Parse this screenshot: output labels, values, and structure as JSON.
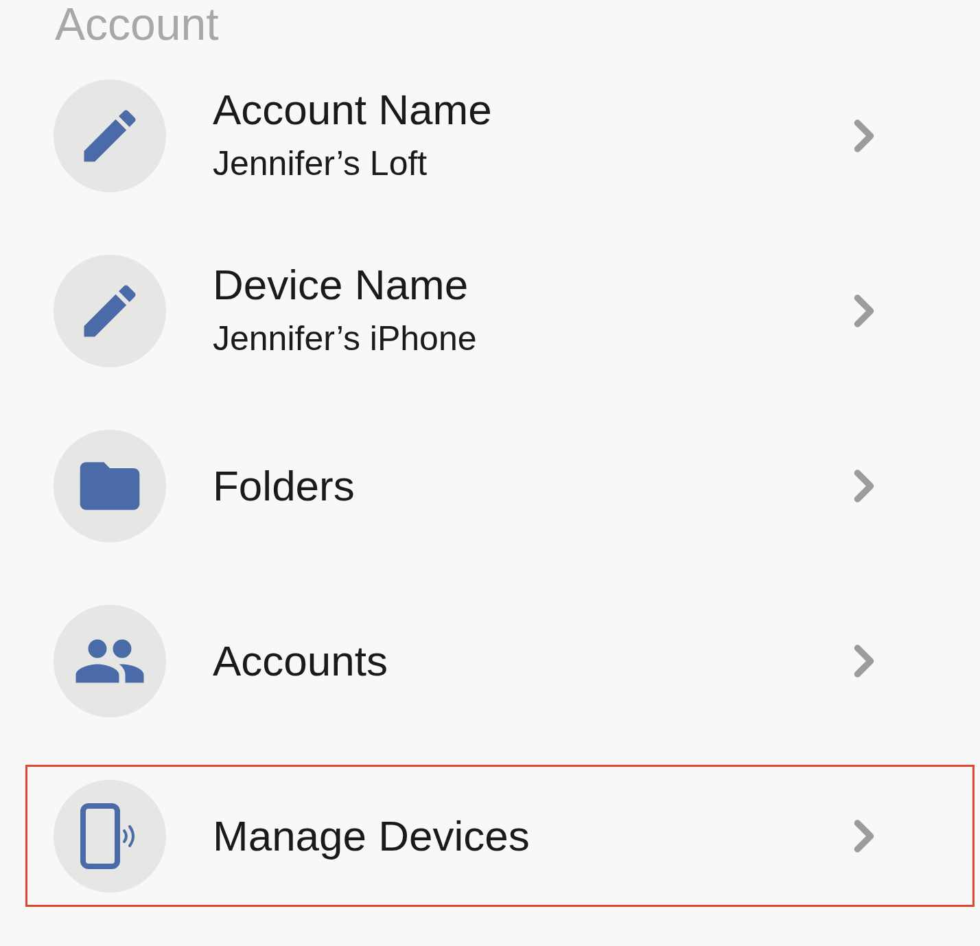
{
  "section_title": "Account",
  "items": [
    {
      "kind": "edit",
      "title": "Account Name",
      "subtitle": "Jennifer’s Loft",
      "highlighted": false
    },
    {
      "kind": "edit",
      "title": "Device Name",
      "subtitle": "Jennifer’s iPhone",
      "highlighted": false
    },
    {
      "kind": "folder",
      "title": "Folders",
      "highlighted": false
    },
    {
      "kind": "people",
      "title": "Accounts",
      "highlighted": false
    },
    {
      "kind": "device",
      "title": "Manage Devices",
      "highlighted": true
    }
  ]
}
